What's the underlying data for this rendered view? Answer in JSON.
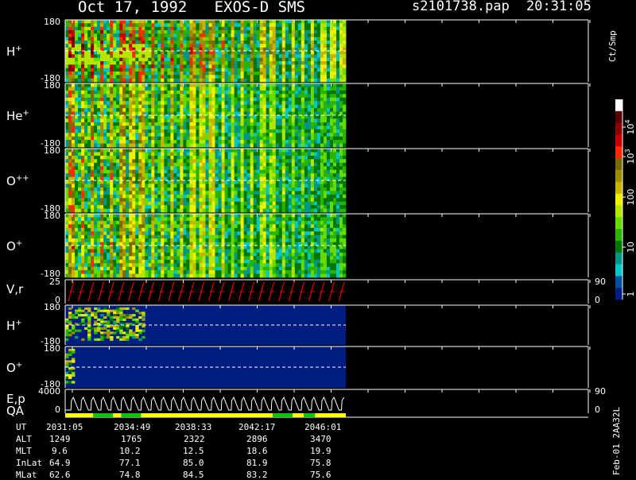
{
  "header": {
    "title": "Oct 17, 1992   EXOS-D SMS",
    "file": "s2101738.pap",
    "time": "20:31:05"
  },
  "colorbar": {
    "unit_label": "Ct/Smp",
    "tick_labels": [
      "10^4",
      "10^3",
      "100",
      "10",
      "1"
    ],
    "colors": [
      "#ffffff",
      "#5a0000",
      "#8c0000",
      "#c80000",
      "#ff2a00",
      "#7a6a00",
      "#a08c00",
      "#c8b400",
      "#f0f000",
      "#b4e600",
      "#64dc00",
      "#28b400",
      "#007800",
      "#009688",
      "#00c8c8",
      "#0050a0",
      "#001e82"
    ]
  },
  "chart_data": [
    {
      "type": "heatmap",
      "panel": "H+ pitch-angle spectrogram",
      "ylabel": "H+",
      "ytick_labels": [
        "180",
        "-180"
      ],
      "ylim": [
        -180,
        180
      ],
      "data_end_fraction": 0.98,
      "dominant_counts": "10-10^4 Ct/Smp, red (~10^3) at spin peaks"
    },
    {
      "type": "heatmap",
      "panel": "He+ pitch-angle spectrogram",
      "ylabel": "He+",
      "ytick_labels": [
        "180",
        "-180"
      ],
      "ylim": [
        -180,
        180
      ],
      "data_end_fraction": 0.98,
      "dominant_counts": "1-10^3 Ct/Smp"
    },
    {
      "type": "heatmap",
      "panel": "O++ pitch-angle spectrogram",
      "ylabel": "O++",
      "ytick_labels": [
        "180",
        "-180"
      ],
      "ylim": [
        -180,
        180
      ],
      "data_end_fraction": 0.98,
      "dominant_counts": "1-10^3 Ct/Smp"
    },
    {
      "type": "heatmap",
      "panel": "O+ pitch-angle spectrogram",
      "ylabel": "O+",
      "ytick_labels": [
        "180",
        "-180"
      ],
      "ylim": [
        -180,
        180
      ],
      "data_end_fraction": 0.98,
      "dominant_counts": "1-10^3 Ct/Smp"
    },
    {
      "type": "line",
      "panel": "V,r",
      "ylabel": "V,r",
      "ytick_labels": [
        "25",
        "0"
      ],
      "ylim": [
        0,
        25
      ],
      "right_tick_labels": [
        "90",
        "0"
      ],
      "series_color": "#e00000",
      "spin_cycles": 28
    },
    {
      "type": "heatmap",
      "panel": "H+ second spectrogram",
      "ylabel": "H+",
      "ytick_labels": [
        "180",
        "-180"
      ],
      "ylim": [
        -180,
        180
      ],
      "data_end_fraction": 0.98,
      "active_fraction": 0.28
    },
    {
      "type": "heatmap",
      "panel": "O+ second spectrogram",
      "ylabel": "O+",
      "ytick_labels": [
        "180",
        "-180"
      ],
      "ylim": [
        -180,
        180
      ],
      "data_end_fraction": 0.98,
      "active_fraction": 0.03
    },
    {
      "type": "line",
      "panel": "E,p",
      "ylabel": "E,p",
      "ytick_labels": [
        "4000",
        "0"
      ],
      "ylim": [
        0,
        4000
      ],
      "right_tick_labels": [
        "90",
        "0"
      ],
      "series_color": "#ffffff",
      "spin_cycles": 28
    },
    {
      "type": "bar",
      "panel": "QA",
      "ylabel": "QA",
      "segments": [
        {
          "color": "#ffff00",
          "span": 0.1
        },
        {
          "color": "#00c800",
          "span": 0.07
        },
        {
          "color": "#ffff00",
          "span": 0.03
        },
        {
          "color": "#00c800",
          "span": 0.07
        },
        {
          "color": "#ffff00",
          "span": 0.47
        },
        {
          "color": "#00c800",
          "span": 0.07
        },
        {
          "color": "#ffff00",
          "span": 0.04
        },
        {
          "color": "#00c800",
          "span": 0.04
        },
        {
          "color": "#ffff00",
          "span": 0.11
        }
      ]
    }
  ],
  "ephemeris": {
    "row_labels": [
      "UT",
      "ALT",
      "MLT",
      "InLat",
      "MLat"
    ],
    "columns": [
      [
        "2031:05",
        "1249",
        "9.6",
        "64.9",
        "62.6"
      ],
      [
        "2034:49",
        "1765",
        "10.2",
        "77.1",
        "74.8"
      ],
      [
        "2038:33",
        "2322",
        "12.5",
        "85.0",
        "84.5"
      ],
      [
        "2042:17",
        "2896",
        "18.6",
        "81.9",
        "83.2"
      ],
      [
        "2046:01",
        "3470",
        "19.9",
        "75.8",
        "75.6"
      ]
    ]
  },
  "footer": {
    "stamp": "Feb-01 2AA32L"
  }
}
